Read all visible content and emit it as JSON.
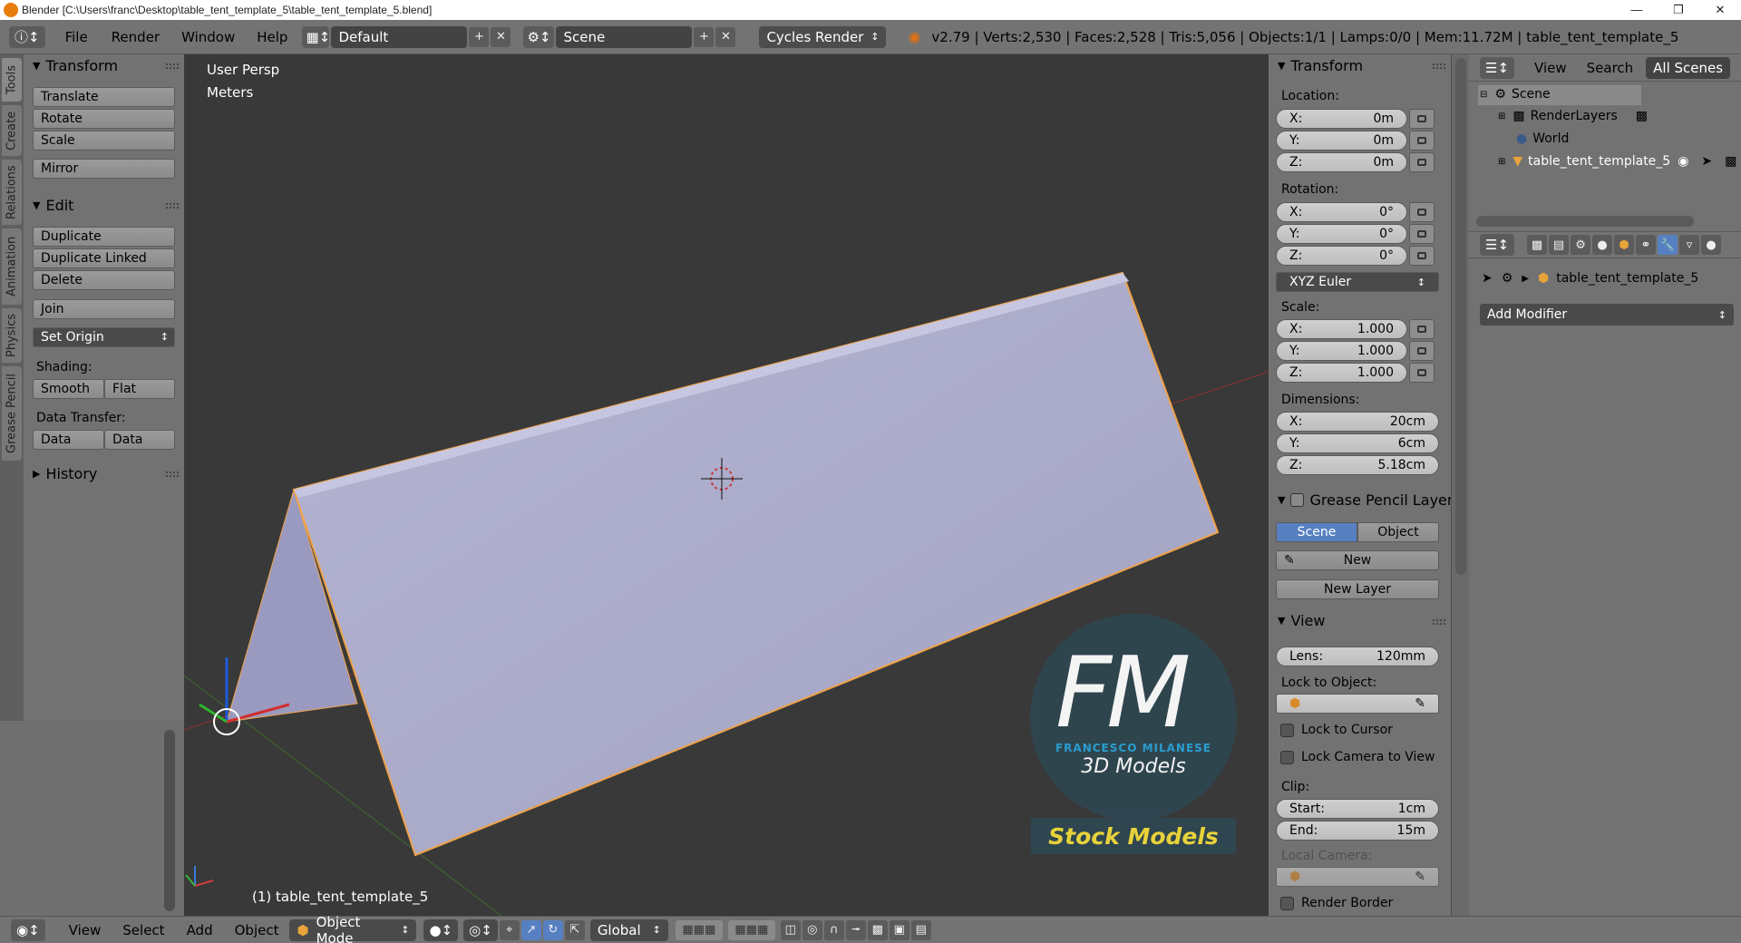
{
  "window": {
    "title": "Blender [C:\\Users\\franc\\Desktop\\table_tent_template_5\\table_tent_template_5.blend]"
  },
  "menubar": {
    "items": [
      "File",
      "Render",
      "Window",
      "Help"
    ],
    "layout": "Default",
    "scene": "Scene",
    "engine": "Cycles Render",
    "stats": "v2.79 | Verts:2,530 | Faces:2,528 | Tris:5,056 | Objects:1/1 | Lamps:0/0 | Mem:11.72M | table_tent_template_5"
  },
  "left_tabs": [
    "Tools",
    "Create",
    "Relations",
    "Animation",
    "Physics",
    "Grease Pencil"
  ],
  "tools": {
    "transform_title": "Transform",
    "translate": "Translate",
    "rotate": "Rotate",
    "scale": "Scale",
    "mirror": "Mirror",
    "edit_title": "Edit",
    "duplicate": "Duplicate",
    "duplicate_linked": "Duplicate Linked",
    "delete": "Delete",
    "join": "Join",
    "set_origin": "Set Origin",
    "shading_label": "Shading:",
    "smooth": "Smooth",
    "flat": "Flat",
    "data_transfer_label": "Data Transfer:",
    "data": "Data",
    "data_layout": "Data Layo",
    "history_title": "History"
  },
  "viewport": {
    "view_name": "User Persp",
    "units": "Meters",
    "object_label": "(1) table_tent_template_5",
    "watermark": {
      "letters": "FM",
      "name": "FRANCESCO MILANESE",
      "sub": "3D Models",
      "tag": "Stock Models"
    }
  },
  "npanel": {
    "transform_title": "Transform",
    "location_label": "Location:",
    "location": {
      "x": "0m",
      "y": "0m",
      "z": "0m"
    },
    "rotation_label": "Rotation:",
    "rotation": {
      "x": "0°",
      "y": "0°",
      "z": "0°"
    },
    "rotation_mode": "XYZ Euler",
    "scale_label": "Scale:",
    "scale": {
      "x": "1.000",
      "y": "1.000",
      "z": "1.000"
    },
    "dimensions_label": "Dimensions:",
    "dimensions": {
      "x": "20cm",
      "y": "6cm",
      "z": "5.18cm"
    },
    "axis": {
      "x": "X:",
      "y": "Y:",
      "z": "Z:"
    },
    "gp_title": "Grease Pencil Layer",
    "scene_btn": "Scene",
    "object_btn": "Object",
    "new_btn": "New",
    "new_layer_btn": "New Layer",
    "view_title": "View",
    "lens_label": "Lens:",
    "lens": "120mm",
    "lock_to_object": "Lock to Object:",
    "lock_to_cursor": "Lock to Cursor",
    "lock_camera": "Lock Camera to View",
    "clip_label": "Clip:",
    "start_label": "Start:",
    "clip_start": "1cm",
    "end_label": "End:",
    "clip_end": "15m",
    "local_camera": "Local Camera:",
    "render_border": "Render Border"
  },
  "outliner": {
    "tabs": [
      "View",
      "Search",
      "All Scenes"
    ],
    "items": [
      "Scene",
      "RenderLayers",
      "World",
      "table_tent_template_5"
    ]
  },
  "properties": {
    "object_name": "table_tent_template_5",
    "add_modifier": "Add Modifier"
  },
  "bottombar": {
    "items": [
      "View",
      "Select",
      "Add",
      "Object"
    ],
    "mode": "Object Mode",
    "orientation": "Global"
  },
  "colors": {
    "accent": "#5680c2",
    "object": "#aaaac8",
    "selection_outline": "#f0a34a",
    "watermark_circle": "#2f4650",
    "watermark_text": "#29a3d8",
    "watermark_tag": "#e8d23a"
  }
}
